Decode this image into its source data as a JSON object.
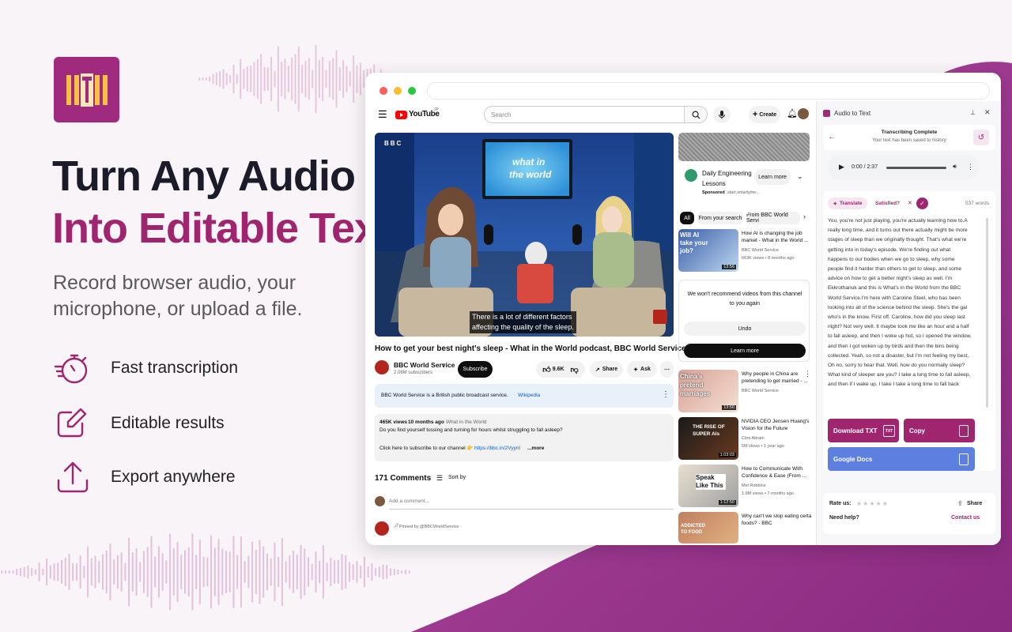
{
  "hero": {
    "title_line1": "Turn Any Audio",
    "title_line2": "Into Editable Text",
    "subtitle": "Record browser audio, your microphone, or upload a file.",
    "features": [
      {
        "icon": "stopwatch-icon",
        "label": "Fast transcription"
      },
      {
        "icon": "edit-icon",
        "label": "Editable results"
      },
      {
        "icon": "upload-icon",
        "label": "Export anywhere"
      }
    ]
  },
  "colors": {
    "brand": "#a0256f",
    "brand_dark": "#a02a7e",
    "brand_bg": "#9b2f86",
    "google_docs": "#5d7fe0",
    "yt_red": "#ff0000"
  },
  "youtube": {
    "logo_text": "YouTube",
    "logo_region": "JP",
    "search_placeholder": "Search",
    "create_label": "Create",
    "video_caption_line1": "There is a lot of different factors",
    "video_caption_line2": "affecting the quality of the sleep.",
    "video_screen_text_1": "what in",
    "video_screen_text_2": "the world",
    "bbc_logo": "BBC",
    "video_title": "How to get your best night's sleep - What in the World podcast, BBC World Service",
    "channel_name": "BBC World Service",
    "subscribers": "2.06M subscribers",
    "subscribe_label": "Subscribe",
    "likes": "9.6K",
    "share_label": "Share",
    "ask_label": "Ask",
    "info_text": "BBC World Service is a British public broadcast service.",
    "info_link": "Wikipedia",
    "desc_views": "465K views",
    "desc_age": "10 months ago",
    "desc_tag": "What in the World",
    "desc_line1": "Do you find yourself tossing and turning for hours whilst struggling to fall asleep?",
    "desc_line2": "Click here to subscribe to our channel",
    "desc_link": "https://bbc.in/2Vyynl",
    "desc_more": "...more",
    "comments_count": "171 Comments",
    "sort_label": "Sort by",
    "add_comment_placeholder": "Add a comment...",
    "pinned": "Pinned by @BBCWorldService",
    "ad_title_1": "Daily Engineering",
    "ad_title_2": "Lessons",
    "ad_sponsored": "Sponsored",
    "ad_domain": "start.smartyme...",
    "ad_button": "Learn more",
    "filter_chips": [
      "All",
      "From your search",
      "From BBC World Servi"
    ],
    "related": [
      {
        "title1": "How AI is changing the job",
        "title2": "market - What in the World ...",
        "channel": "BBC World Service",
        "meta": "663K views • 8 months ago",
        "duration": "13:56",
        "thumb_text": "Will AI take your job?"
      },
      {
        "title1": "Why people in China are",
        "title2": "pretending to get married - ...",
        "channel": "BBC World Service",
        "meta": "",
        "duration": "13:50",
        "thumb_text": "China's pretend marriages"
      },
      {
        "title1": "NVIDIA CEO Jensen Huang's",
        "title2": "Vision for the Future",
        "channel": "Cleo Abram",
        "meta": "5M views • 1 year ago",
        "duration": "1:03:03",
        "thumb_text": "THE RISE OF SUPER AIs"
      },
      {
        "title1": "How to Communicate With",
        "title2": "Confidence & Ease (From ...",
        "channel": "Mel Robbins",
        "meta": "1.9M views • 7 months ago",
        "duration": "1:12:50",
        "thumb_text": "Speak Like This"
      },
      {
        "title1": "Why can't we stop eating certa",
        "title2": "foods? - BBC",
        "channel": "",
        "meta": "",
        "duration": "",
        "thumb_text": "ADDICTED TO FOOD"
      }
    ],
    "no_recommend": "We won't recommend videos from this channel to you again",
    "undo_label": "Undo",
    "learn_more_label": "Learn more"
  },
  "panel": {
    "title": "Audio to Text",
    "status_title": "Transcribing Complete",
    "status_sub": "Your text has been saved to history",
    "audio_time": "0:00 / 2:37",
    "translate_label": "Translate",
    "satisfied_label": "Satisfied?",
    "word_count": "537 words",
    "transcript": "You, you're not just playing, you're actually learning how to.A really long time, and it turns out there actually might be more stages of sleep than we originally thought. That's what we're getting into in today's episode. We're finding out what happens to our bodies when we go to sleep, why some people find it harder than others to get to sleep, and some advice on how to get a better night's sleep as well. I'm Ekkrothanuk and this is What's in the World from the BBC World Service.I'm here with Caroline Steel, who has been looking into all of the science behind the sleep. She's the gal who's in the know. First off. Caroline, how did you sleep last night? Not very well. It maybe took me like an hour and a half to fall asleep, and then I woke up hot, so I opened the window, and then I got woken up by birds and then the bins being collected. Yeah, so not a disaster, but I'm not feeling my best. Oh no, sorry to hear that. Well, how do you normally sleep? What kind of sleeper are you? I take a long time to fall asleep, and then if I wake up, I take I take a long time to fall back",
    "download_label": "Download TXT",
    "txt_badge": "TXT",
    "copy_label": "Copy",
    "google_docs_label": "Google Docs",
    "rate_label": "Rate us:",
    "stars": "★★★★★",
    "share_label": "Share",
    "help_label": "Need help?",
    "contact_label": "Contact us"
  }
}
